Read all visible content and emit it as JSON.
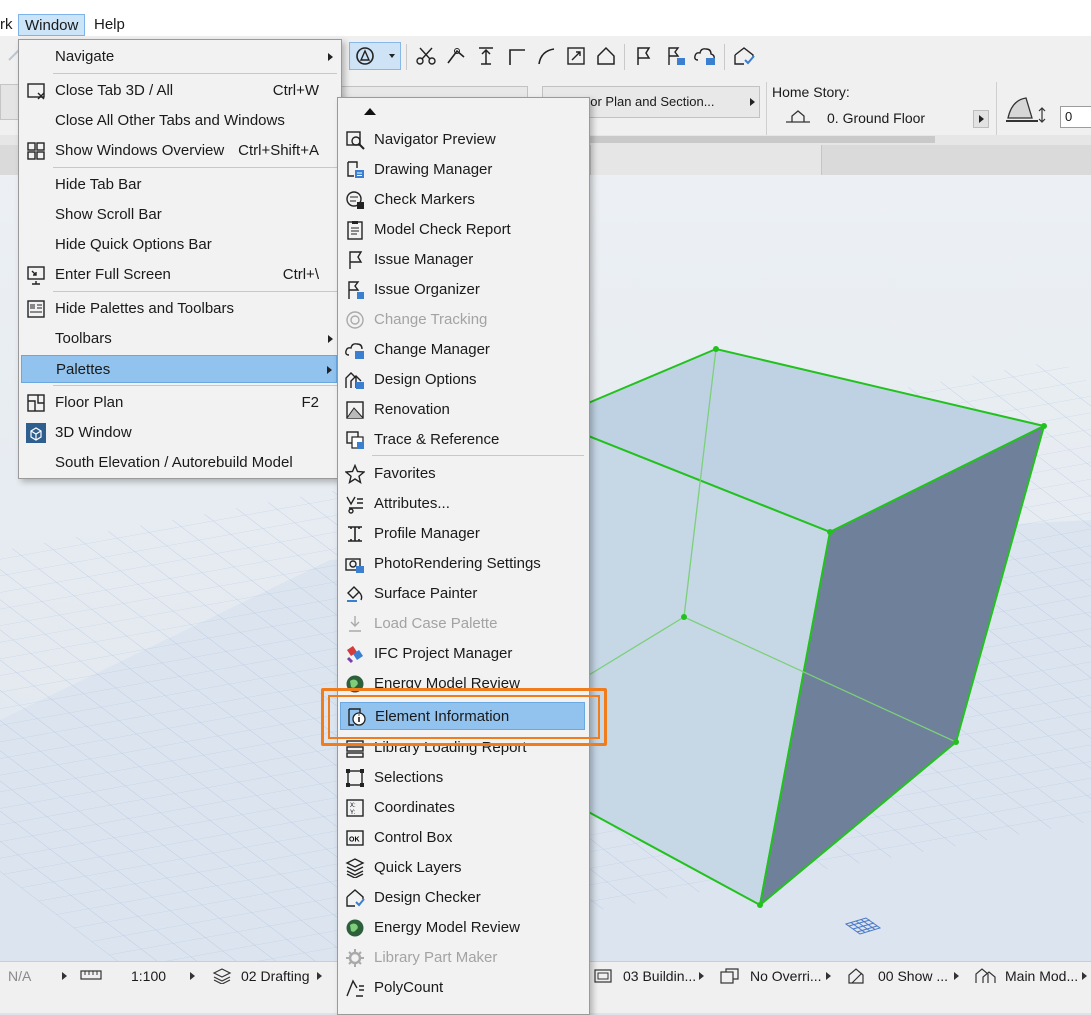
{
  "menubar": {
    "partial_item": "rk",
    "window": "Window",
    "help": "Help"
  },
  "infobar": {
    "view_dropdown": "oor Plan and Section...",
    "home_story_label": "Home Story:",
    "home_story_value": "0. Ground Floor",
    "offset_value": "0"
  },
  "window_menu": [
    {
      "label": "Navigate",
      "submenu": true
    },
    {
      "label": "Close Tab 3D / All",
      "shortcut": "Ctrl+W",
      "icon": "close-tab-icon"
    },
    {
      "label": "Close All Other Tabs and Windows"
    },
    {
      "label": "Show Windows Overview",
      "shortcut": "Ctrl+Shift+A",
      "icon": "windows-overview-icon"
    },
    {
      "label": "Hide Tab Bar"
    },
    {
      "label": "Show Scroll Bar"
    },
    {
      "label": "Hide Quick Options Bar"
    },
    {
      "label": "Enter Full Screen",
      "shortcut": "Ctrl+\\",
      "icon": "full-screen-icon"
    },
    {
      "label": "Hide Palettes and Toolbars",
      "icon": "palettes-icon"
    },
    {
      "label": "Toolbars",
      "submenu": true
    },
    {
      "label": "Palettes",
      "submenu": true,
      "highlighted": true
    },
    {
      "label": "Floor Plan",
      "shortcut": "F2",
      "icon": "floor-plan-icon"
    },
    {
      "label": "3D Window",
      "icon": "3d-window-icon"
    },
    {
      "label": "South Elevation / Autorebuild Model"
    }
  ],
  "palettes_menu": [
    {
      "label": "Navigator Preview",
      "icon": "navigator-preview-icon"
    },
    {
      "label": "Drawing Manager",
      "icon": "drawing-manager-icon"
    },
    {
      "label": "Check Markers",
      "icon": "check-markers-icon"
    },
    {
      "label": "Model Check Report",
      "icon": "model-check-report-icon"
    },
    {
      "label": "Issue Manager",
      "icon": "issue-manager-icon"
    },
    {
      "label": "Issue Organizer",
      "icon": "issue-organizer-icon"
    },
    {
      "label": "Change Tracking",
      "icon": "change-tracking-icon",
      "disabled": true
    },
    {
      "label": "Change Manager",
      "icon": "change-manager-icon"
    },
    {
      "label": "Design Options",
      "icon": "design-options-icon"
    },
    {
      "label": "Renovation",
      "icon": "renovation-icon"
    },
    {
      "label": "Trace & Reference",
      "icon": "trace-reference-icon"
    },
    {
      "label": "Favorites",
      "icon": "favorites-icon"
    },
    {
      "label": "Attributes...",
      "icon": "attributes-icon"
    },
    {
      "label": "Profile Manager",
      "icon": "profile-manager-icon"
    },
    {
      "label": "PhotoRendering Settings",
      "icon": "photorendering-icon"
    },
    {
      "label": "Surface Painter",
      "icon": "surface-painter-icon"
    },
    {
      "label": "Load Case Palette",
      "icon": "load-case-icon",
      "disabled": true
    },
    {
      "label": "IFC Project Manager",
      "icon": "ifc-project-manager-icon"
    },
    {
      "label": "Energy Model Review",
      "icon": "energy-model-review-icon"
    },
    {
      "label": "Element Information",
      "icon": "element-information-icon",
      "highlighted": true
    },
    {
      "label": "Library Loading Report",
      "icon": "library-loading-report-icon"
    },
    {
      "label": "Selections",
      "icon": "selections-icon"
    },
    {
      "label": "Coordinates",
      "icon": "coordinates-icon"
    },
    {
      "label": "Control Box",
      "icon": "control-box-icon"
    },
    {
      "label": "Quick Layers",
      "icon": "quick-layers-icon"
    },
    {
      "label": "Design Checker",
      "icon": "design-checker-icon"
    },
    {
      "label": "Energy Model Review",
      "icon": "energy-model-review-icon"
    },
    {
      "label": "Library Part Maker",
      "icon": "library-part-maker-icon",
      "disabled": true
    },
    {
      "label": "PolyCount",
      "icon": "polycount-icon"
    }
  ],
  "statusbar": {
    "na": "N/A",
    "scale": "1:100",
    "layer_combo": "02 Drafting",
    "model_view": "03 Buildin...",
    "override": "No Overri...",
    "show": "00 Show ...",
    "main_model": "Main Mod..."
  },
  "colors": {
    "highlight": "#91c3ee",
    "callout": "#f07c1c",
    "edge_green": "#22c21e",
    "dark_face": "#6f809b"
  }
}
